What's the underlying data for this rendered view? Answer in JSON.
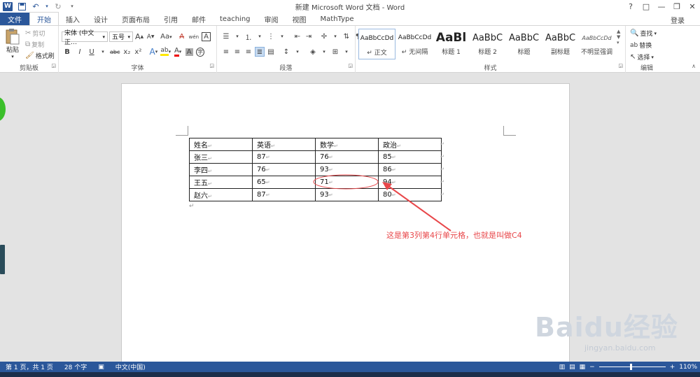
{
  "window": {
    "title": "新建 Microsoft Word 文档 - Word",
    "app_icon": "W",
    "controls": [
      "?",
      "□",
      "—",
      "❐",
      "✕"
    ]
  },
  "tabs": {
    "items": [
      "文件",
      "开始",
      "插入",
      "设计",
      "页面布局",
      "引用",
      "邮件",
      "teaching",
      "审阅",
      "视图",
      "MathType"
    ],
    "active": "开始",
    "login": "登录"
  },
  "ribbon": {
    "clipboard": {
      "label": "剪贴板",
      "paste": "粘贴",
      "cut": "剪切",
      "copy": "复制",
      "format_painter": "格式刷"
    },
    "font": {
      "label": "字体",
      "font_name": "宋体 (中文正…",
      "font_size": "五号",
      "grow": "A",
      "shrink": "A",
      "case": "Aa",
      "clear": "A",
      "phonetic": "wén",
      "border": "A",
      "bold": "B",
      "italic": "I",
      "underline": "U",
      "strike": "abc",
      "sub": "x₂",
      "sup": "x²",
      "effects": "A",
      "highlight": "ab",
      "color": "A",
      "shade": "A",
      "circle": "字"
    },
    "paragraph": {
      "label": "段落"
    },
    "styles": {
      "label": "样式",
      "items": [
        {
          "preview": "AaBbCcDd",
          "name": "↵ 正文"
        },
        {
          "preview": "AaBbCcDd",
          "name": "↵ 无间隔"
        },
        {
          "preview": "AaBl",
          "name": "标题 1"
        },
        {
          "preview": "AaBbC",
          "name": "标题 2"
        },
        {
          "preview": "AaBbC",
          "name": "标题"
        },
        {
          "preview": "AaBbC",
          "name": "副标题"
        },
        {
          "preview": "AaBbCcDd",
          "name": "不明显强调"
        }
      ]
    },
    "editing": {
      "label": "编辑",
      "find": "查找",
      "replace": "替换",
      "select": "选择"
    }
  },
  "document": {
    "table": {
      "headers": [
        "姓名",
        "英语",
        "数学",
        "政治"
      ],
      "rows": [
        [
          "张三",
          "87",
          "76",
          "85"
        ],
        [
          "李四",
          "76",
          "93",
          "86"
        ],
        [
          "王五",
          "65",
          "71",
          "94"
        ],
        [
          "赵六",
          "87",
          "93",
          "80"
        ]
      ]
    },
    "annotation": "这是第3列第4行单元格，也就是叫做C4",
    "paragraph_mark": "↵"
  },
  "status": {
    "page": "第 1 页，共 1 页",
    "words": "28 个字",
    "language": "中文(中国)",
    "zoom": "110%"
  },
  "watermark": {
    "brand": "Baidu经验",
    "url": "jingyan.baidu.com"
  },
  "colors": {
    "accent": "#2b579a",
    "annotation": "#e8474a"
  }
}
